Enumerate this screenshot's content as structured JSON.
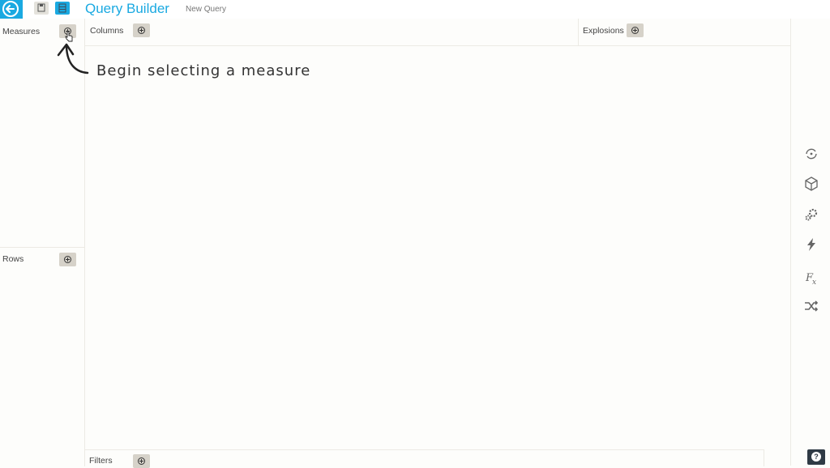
{
  "header": {
    "title": "Query Builder",
    "query_name": "New Query"
  },
  "panels": {
    "measures": "Measures",
    "columns": "Columns",
    "explosions": "Explosions",
    "rows": "Rows",
    "filters": "Filters"
  },
  "annotation": "Begin selecting a measure",
  "help_label": "?",
  "colors": {
    "accent": "#1aa9e1",
    "add_button": "#d6d2c9",
    "help_button": "#2f3a45"
  },
  "rail_icons": [
    "refresh-icon",
    "cube-icon",
    "gears-icon",
    "lightning-icon",
    "function-icon",
    "shuffle-icon"
  ]
}
